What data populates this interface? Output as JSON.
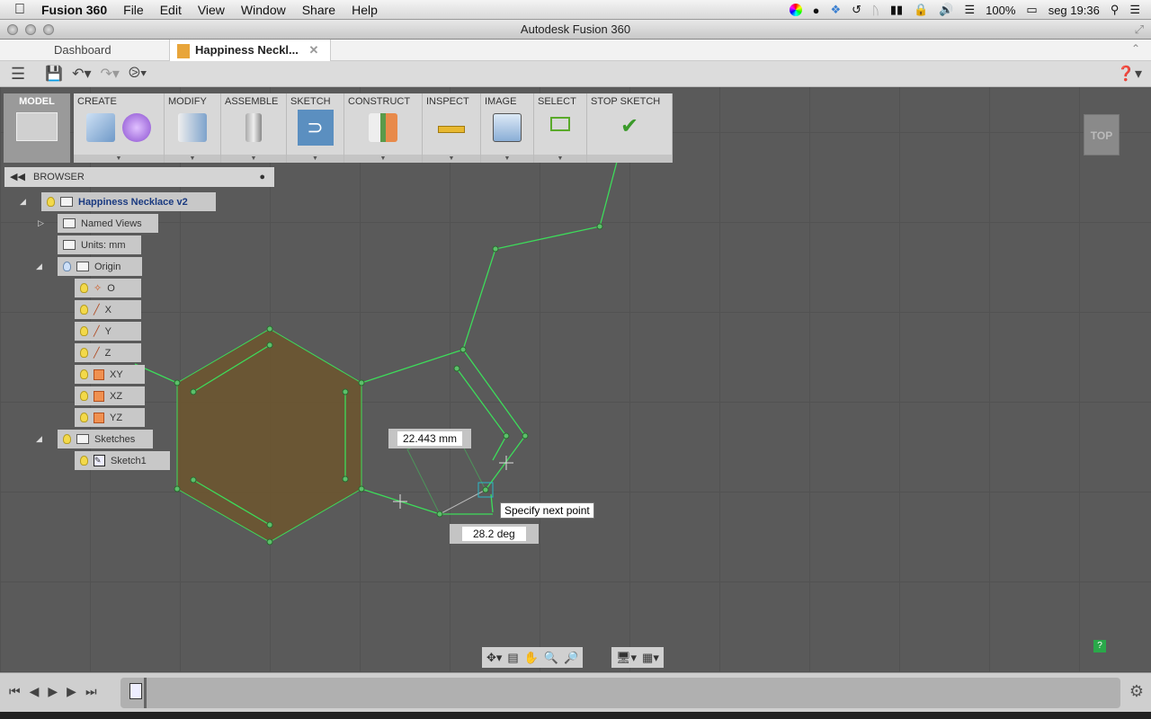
{
  "menubar": {
    "app": "Fusion 360",
    "items": [
      "File",
      "Edit",
      "View",
      "Window",
      "Share",
      "Help"
    ],
    "status": {
      "battery": "100%",
      "clock": "seg 19:36"
    }
  },
  "window": {
    "title": "Autodesk Fusion 360"
  },
  "tabs": [
    {
      "label": "Dashboard"
    },
    {
      "label": "Happiness Neckl...",
      "active": true
    }
  ],
  "ribbon": {
    "workspace": "MODEL",
    "panels": [
      "CREATE",
      "MODIFY",
      "ASSEMBLE",
      "SKETCH",
      "CONSTRUCT",
      "INSPECT",
      "IMAGE",
      "SELECT",
      "STOP SKETCH"
    ]
  },
  "browser": {
    "title": "BROWSER",
    "root": "Happiness Necklace v2",
    "nodes": {
      "named_views": "Named Views",
      "units": "Units: mm",
      "origin": "Origin",
      "o": "O",
      "x": "X",
      "y": "Y",
      "z": "Z",
      "xy": "XY",
      "xz": "XZ",
      "yz": "YZ",
      "sketches": "Sketches",
      "sketch1": "Sketch1"
    }
  },
  "sketch": {
    "length_input": "22.443 mm",
    "angle_input": "28.2 deg",
    "tooltip": "Specify next point",
    "line_color": "#3ddc5a",
    "profile_fill": "#6b5530"
  },
  "viewcube": {
    "face": "TOP"
  },
  "colors": {
    "accent": "#5b8fc0"
  }
}
